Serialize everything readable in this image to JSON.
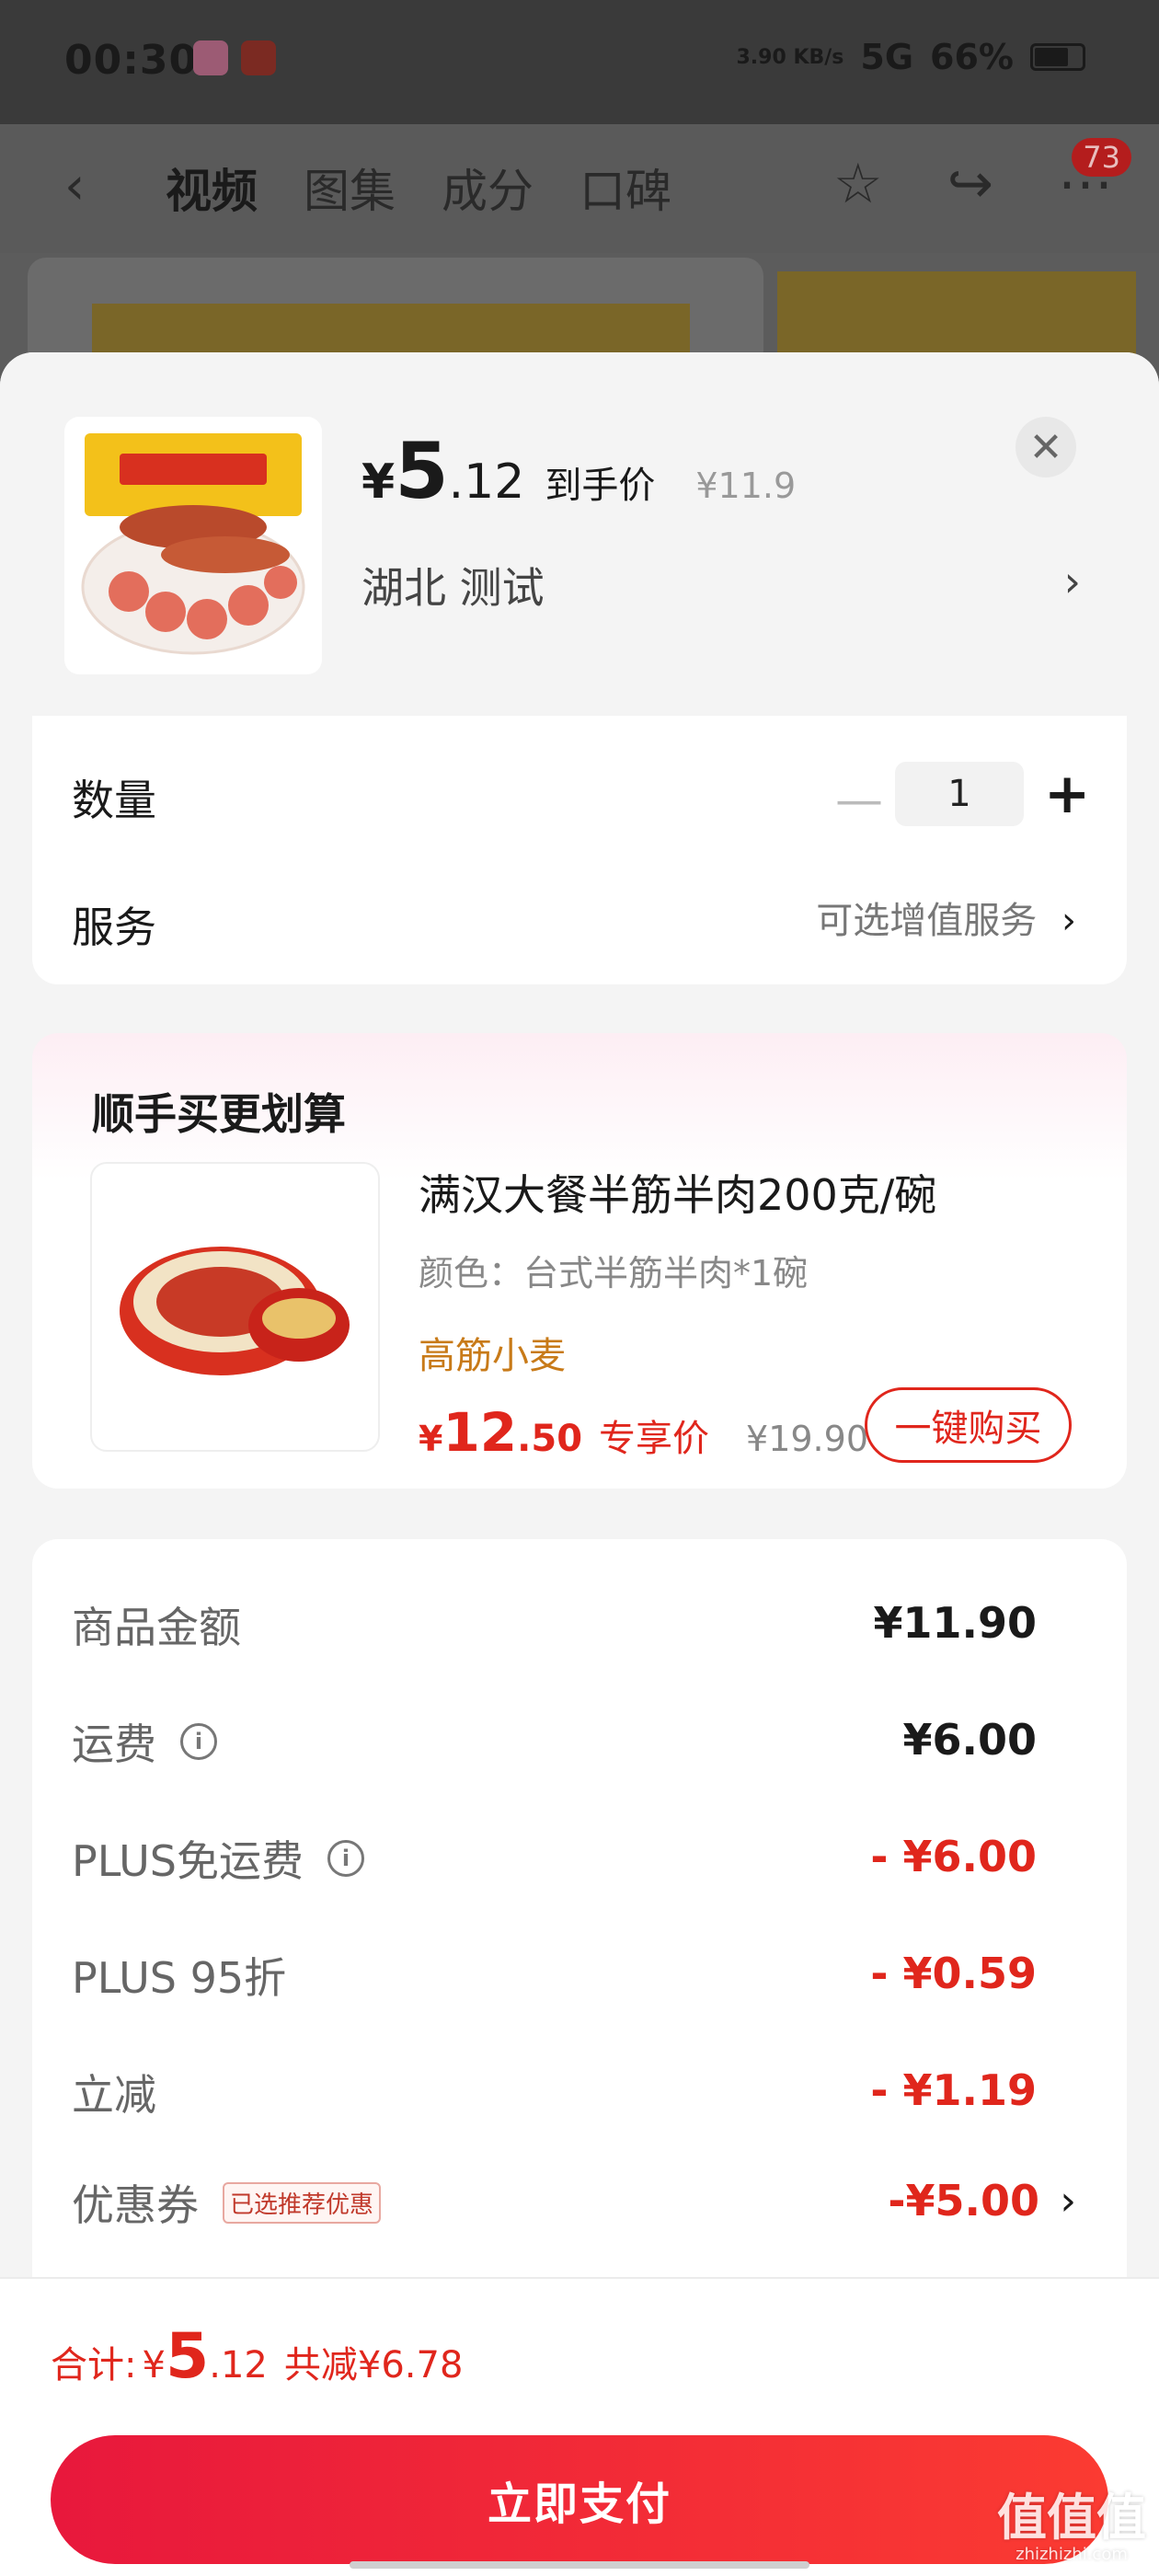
{
  "status_bar": {
    "time": "00:30",
    "network_speed": "3.90 KB/s",
    "signal": "5G",
    "battery": "66%"
  },
  "nav": {
    "tabs": [
      "视频",
      "图集",
      "成分",
      "口碑"
    ],
    "badge_count": "73"
  },
  "product": {
    "currency": "¥",
    "price_int": "5",
    "price_dec": ".12",
    "price_label": "到手价",
    "original_price": "¥11.9",
    "region": "湖北  测试"
  },
  "quantity": {
    "label": "数量",
    "value": "1"
  },
  "service": {
    "label": "服务",
    "value": "可选增值服务"
  },
  "addon": {
    "section_title": "顺手买更划算",
    "name": "满汉大餐半筋半肉200克/碗",
    "spec": "颜色：台式半筋半肉*1碗",
    "tag": "高筋小麦",
    "currency": "¥",
    "price_int": "12",
    "price_dec": ".50",
    "price_label": "专享价",
    "original_price": "¥19.90",
    "buy_label": "一键购买"
  },
  "fees": [
    {
      "label": "商品金额",
      "value": "¥11.90",
      "info": false,
      "red": false
    },
    {
      "label": "运费",
      "value": "¥6.00",
      "info": true,
      "red": false
    },
    {
      "label": "PLUS免运费",
      "value": "- ¥6.00",
      "info": true,
      "red": true
    },
    {
      "label": "PLUS 95折",
      "value": "- ¥0.59",
      "info": false,
      "red": true
    },
    {
      "label": "立减",
      "value": "- ¥1.19",
      "info": false,
      "red": true
    }
  ],
  "coupon": {
    "label": "优惠券",
    "tag": "已选推荐优惠",
    "value": "-¥5.00"
  },
  "summary": {
    "label": "合计:",
    "currency": "¥",
    "total_int": "5",
    "total_dec": ".12",
    "saved": "共减¥6.78"
  },
  "pay_button": "立即支付",
  "watermark": {
    "main": "值值值",
    "sub": "zhizhizhi.com"
  },
  "colors": {
    "accent_red": "#e0261c",
    "addon_tag": "#c87a18"
  }
}
